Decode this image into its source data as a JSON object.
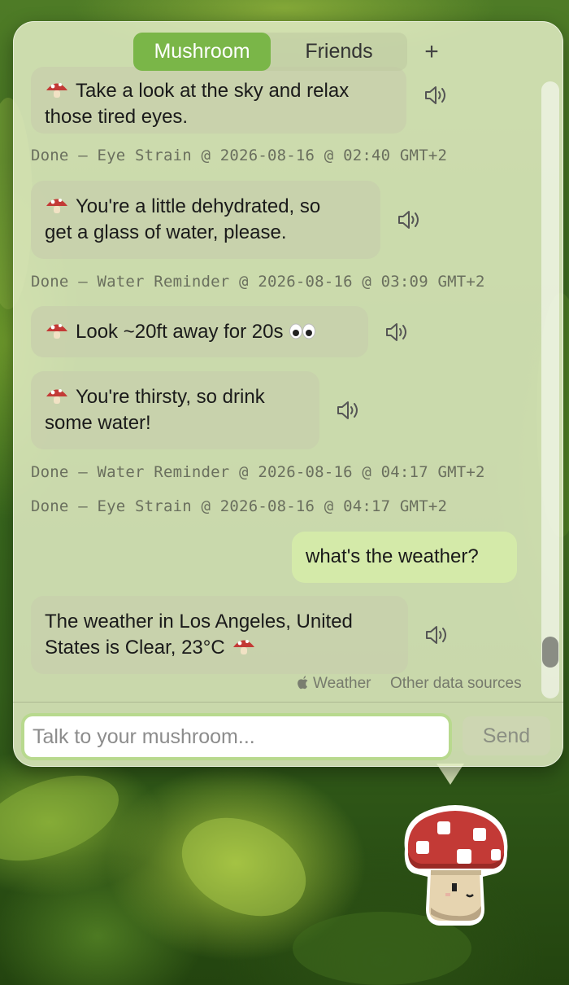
{
  "tabs": [
    {
      "label": "Mushroom",
      "active": true
    },
    {
      "label": "Friends",
      "active": false
    }
  ],
  "add_tab_label": "+",
  "messages": [
    {
      "role": "assistant",
      "emoji": "mushroom",
      "text_line1": "Take a look at the sky and relax",
      "text_line2": "those tired eyes."
    },
    {
      "role": "log",
      "text": "Done – Eye Strain @ 2026-08-16 @ 02:40 GMT+2"
    },
    {
      "role": "assistant",
      "emoji": "mushroom",
      "text_line1": "You're a little dehydrated, so",
      "text_line2": "get a glass of water, please."
    },
    {
      "role": "log",
      "text": "Done – Water Reminder @ 2026-08-16 @ 03:09 GMT+2"
    },
    {
      "role": "assistant",
      "emoji": "mushroom",
      "text_line1": "Look ~20ft away for 20s",
      "trailing_emoji": "eyes"
    },
    {
      "role": "assistant",
      "emoji": "mushroom",
      "text_line1": "You're thirsty, so drink",
      "text_line2": "some water!"
    },
    {
      "role": "log",
      "text": "Done – Water Reminder @ 2026-08-16 @ 04:17 GMT+2"
    },
    {
      "role": "log",
      "text": "Done – Eye Strain @ 2026-08-16 @ 04:17 GMT+2"
    },
    {
      "role": "user",
      "text_line1": "what's the weather?"
    },
    {
      "role": "assistant",
      "text_line1": "The weather in Los Angeles, United",
      "text_line2": "States is Clear, 23°C",
      "trailing_emoji": "mushroom"
    }
  ],
  "attribution": {
    "weather_label": "Weather",
    "other_label": "Other data sources"
  },
  "composer": {
    "placeholder": "Talk to your mushroom...",
    "value": "",
    "send_label": "Send"
  },
  "icons": {
    "speaker": "speaker-icon",
    "mushroom": "mushroom-emoji",
    "eyes": "eyes-emoji",
    "apple": "apple-icon",
    "mascot": "mushroom-mascot"
  },
  "colors": {
    "accent": "#7ab648",
    "panel": "#e2ecc4",
    "log_text": "#6a6f5e",
    "user_bubble": "#d5eca8",
    "mushroom_red": "#c33a36"
  }
}
